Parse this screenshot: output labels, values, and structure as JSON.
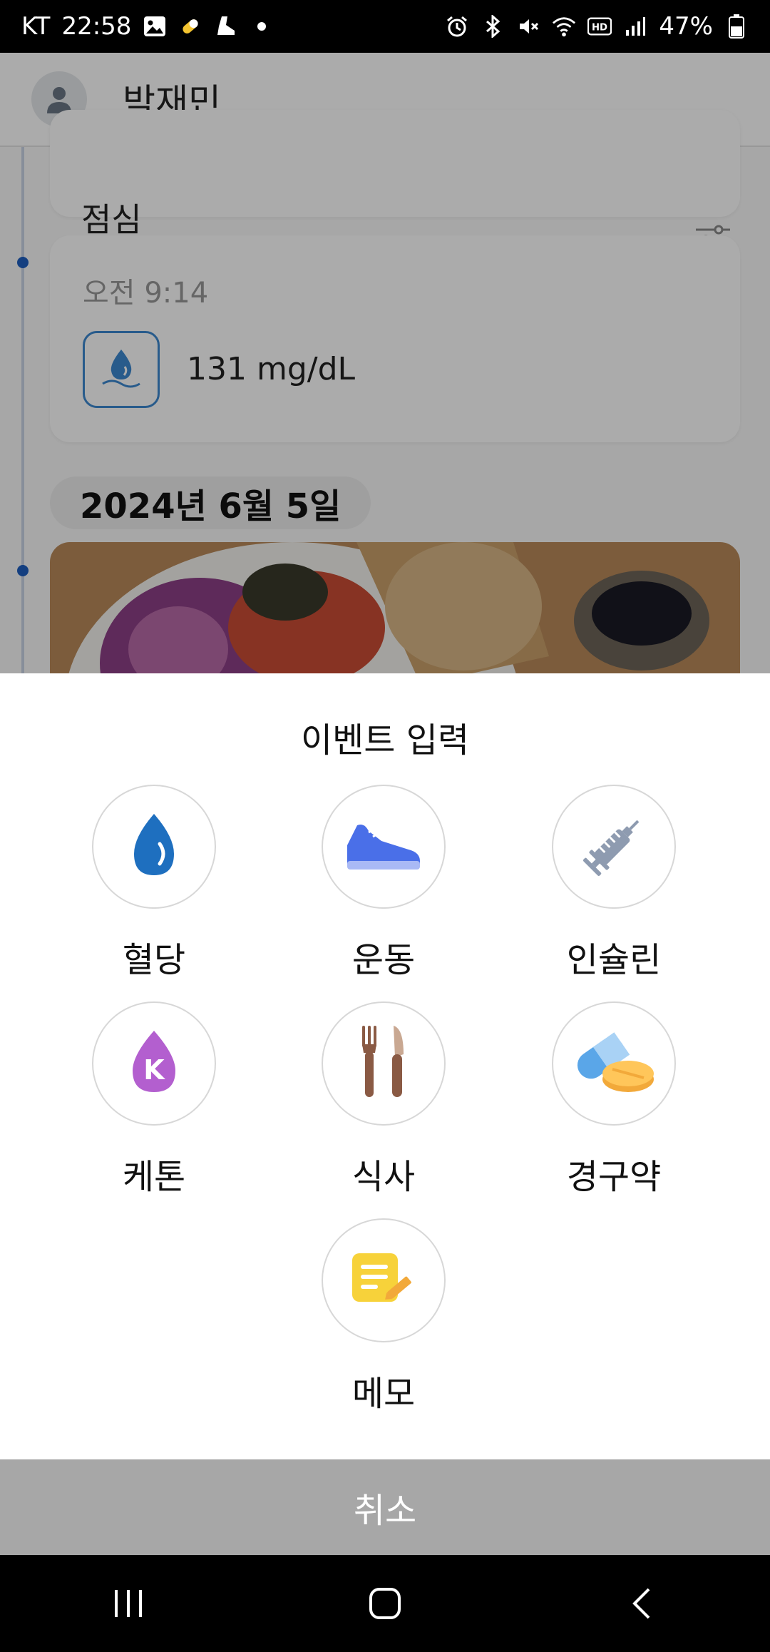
{
  "status_bar": {
    "carrier": "KT",
    "time": "22:58",
    "battery": "47%",
    "icons": [
      "gallery-icon",
      "pill-app-icon",
      "shoe-app-icon",
      "dot-icon",
      "alarm-icon",
      "bluetooth-icon",
      "mute-icon",
      "wifi-icon",
      "hd-icon",
      "signal-icon",
      "battery-icon"
    ]
  },
  "app_bar": {
    "user_name": "박재민",
    "avatar_icon": "person-icon"
  },
  "timeline": {
    "meal_card": {
      "label": "점심",
      "icon": "filter-icon"
    },
    "glucose_card": {
      "time": "오전 9:14",
      "value": "131 mg/dL",
      "icon": "blood-drop-icon"
    },
    "date_chip": "2024년 6월 5일",
    "photo": "meal-photo"
  },
  "sheet": {
    "title": "이벤트 입력",
    "items": [
      {
        "label": "혈당",
        "icon": "blood-drop-icon"
      },
      {
        "label": "운동",
        "icon": "sneaker-icon"
      },
      {
        "label": "인슐린",
        "icon": "syringe-icon"
      },
      {
        "label": "케톤",
        "icon": "ketone-drop-icon"
      },
      {
        "label": "식사",
        "icon": "fork-knife-icon"
      },
      {
        "label": "경구약",
        "icon": "pill-icon"
      },
      {
        "label": "메모",
        "icon": "memo-icon"
      }
    ],
    "cancel_label": "취소"
  },
  "colors": {
    "accent_blue": "#1e6fbf",
    "cancel_bar": "#a7a7a7",
    "ketone_purple": "#b35fcf",
    "memo_yellow": "#f7d23a"
  },
  "nav": {
    "icons": [
      "recent-apps-icon",
      "home-icon",
      "back-icon"
    ]
  }
}
